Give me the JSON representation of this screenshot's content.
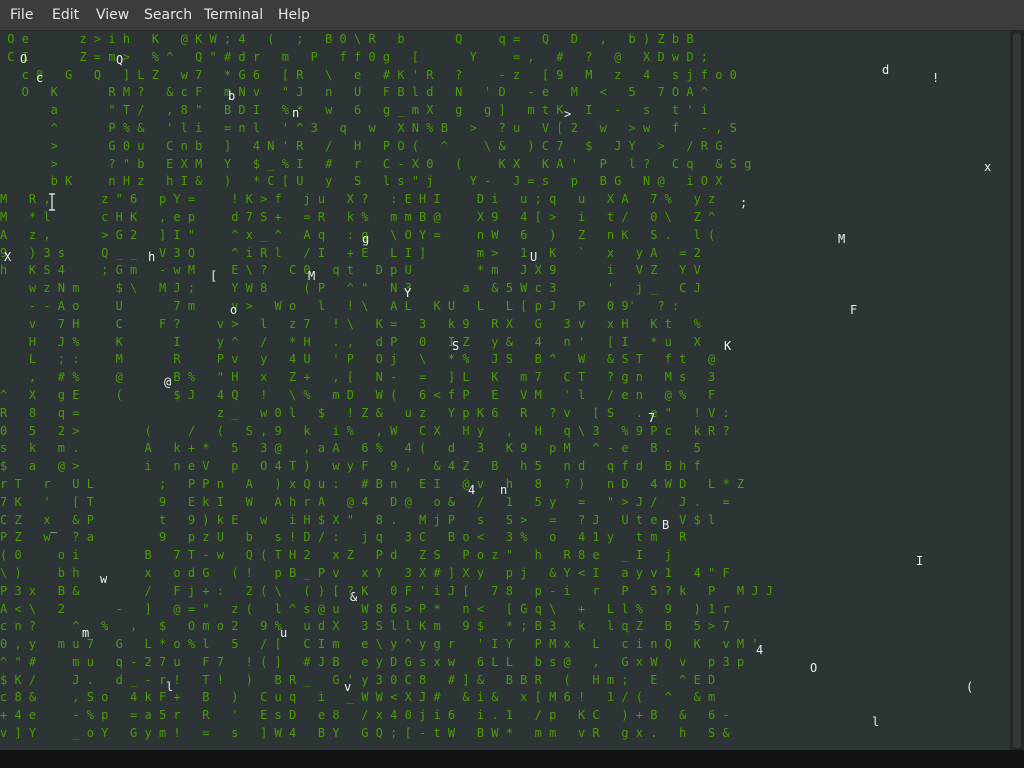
{
  "menubar": {
    "items": [
      "File",
      "Edit",
      "View",
      "Search",
      "Terminal",
      "Help"
    ]
  },
  "terminal": {
    "text_color": "#4e9a06",
    "bright_color": "#eeeeee",
    "background": "#2c3436",
    "lines": [
      " O e       z > i h   K   @ K W ; 4   (   ;   B 0 \\ R   b       Q     q =   Q   D   ,   b ) Z b B",
      " C I       Z = m >   % ^   Q \" # d r   m   P   f f 0 g   [       Y     = ,   #   ?   @   X D w D ;",
      "   c 8   G   Q   ] L Z   w 7   * G 6   [ R   \\   e   # K ' R   ?     - z   [ 9   M   z   4   s j f o 0",
      "   O   K       R M ?   & c F   m N v   \" J   n   U   F B l d   N   ' D   - e   M   <   5   7 O A ^",
      "       a       \" T /   , 8 \"   B D I   % *   w   6   g _ m X   g   g ]   m t K   I   -   s   t ' i",
      "       ^       P % &   ' l i   = n l   ' ^ 3   q   w   X N % B   >   ? u   V [ 2   w   > w   f   - , S",
      "       >       G 0 u   C n b   ]   4 N ' R   /   H   P O (   ^     \\ &   ) C 7   $   J Y   >   / R G",
      "       >       ? \" b   E X M   Y   $ _ % I   #   r   C - X 0   (     K X   K A '   P   l ?   C q   & S g",
      "       b K     n H z   h I &   )   * C [ U   y   S   l s \" j     Y -   J = s   p   B G   N @   i O X",
      "M   R ,       z \" 6   p Y =     ! K > f   j u   X ?   : E H I     D i   u ; q   u   X A   7 %   y z",
      "M   * l       c H K   , e p     d 7 S +   = R   k %   m m B @     X 9   4 [ >   i   t /   0 \\   Z ^",
      "A   z ,       > G 2   ] I \"     ^ x _ ^   A q   : g   \\ O Y =     n W   6   )   Z   n K   S .   l (",
      "9   ) 3 s     Q _ _   V 3 Q     ^ i R l   / I   + E   L I ]       m >   1   K   `   x   y A   = 2",
      "h   K S 4     ; G m   - w M     E \\ ?   C 0   q t   D p U         * m   J X 9       i   V Z   Y V",
      "    w z N m     $ \\   M J ;     Y W 8     ( P   ^ \"   N 3       a   & 5 W c 3       '   j _   C J",
      "    - - A o     U       7 m     v >   W o   l   ! \\   A L   K U   L   L [ p J   P   0 9'   ? :",
      "    v   7 H     C     F ?     v >   l   z 7   ! \\   K =   3   k 9   R X   G   3 v   x H   K t   %",
      "    H   J %     K       I     y ^   /   * H   . ,   d P   0   I Z   y &   4   n '   [ I   * u   X",
      "    L   ; :     M       R     P v   y   4 U   ' P   O j   \\   * %   J S   B ^   W   & S T   f t   @",
      "    ,   # %     @       B %   \" H   x   Z +   , [   N -   =   ] L   K   m 7   C T   ? g n   M s   3",
      "^   X   g E     (       $ J   4 Q   !   \\ %   m D   W (   6 < f P   E   V M   ' l   / e n   @ %   F",
      "R   8   q =                   z _   w 0 l   $   ! Z &   u z   Y p K 6   R   ? v   [ S   . e \"   ! V :",
      "0   5   2 >         (     /   (   S , 9   k   i %   , W   C X   H y   ,   H   q \\ 3   % 9 P c   k R ?",
      "s   k   m .         A   k + *   5   3 @   , a A   6 %   4 (   d   3   K 9   p M   ^ - e   B .   5",
      "$   a   @ >         i   n e V   p   O 4 T )   w y F   9 ,   & 4 Z   B   h 5   n d   q f d   B h f",
      "r T   r   U L         ;   P P n   A   ) x Q u :   # B n   E I   @ v   h   8   ? )   n D   4 W D   L * Z",
      "7 K   '   [ T         9   E k I   W   A h r A   @ 4   D @   o &   /   1   5 y   =   \" > J /   J .   =",
      "C Z   x   & P         t   9 ) k E   w   i H $ X \"   8 .   M j P   s   S >   =   ? J   U t e   V $ l",
      "P Z   w   ? a         9   p z U   b   s ! D / :   j q   3 C   B o <   3 %   o   4 1 y   t m   R",
      "( 0     o i         B   7 T - w   Q ( T H 2   x Z   P d   Z S   P o z \"   h   R 8 e   _ I   j",
      "\\ )     b h         x   o d G   ( !   p B _ P v   x Y   3 X # ] X y   p j   & Y < I   a y v 1   4 \" F",
      "P 3 x   B &         /   F j + :   2 ( \\   ( ) [ ? K   0 F ' i J [   7 8   p - i   r   P   5 ? k   P   M J J",
      "A < \\   2       -   ]   @ = \"   z (   l ^ s @ u   W 8 6 > P *   n <   [ G q \\   +   L l %   9   ) 1 r",
      "c n ?     ^   %   ,   $   O m o 2   9 %   u d X   3 S l l K m   9 $   * ; B 3   k   l q Z   B   5 > 7",
      "0 , y   m u 7   G   L * o % l   5   / [   C I m   e \\ y ^ y g r   ' I Y   P M x   L   c i n Q   K   v M '",
      "^ \" #     m u   q - 2 7 u   F 7   ! ( ]   # J B   e y D G s x w   6 L L   b s @   ,   G x W   v   p 3 p",
      "$ K /     J .   d _ - r !   T !   )   B R _   G ' y 3 0 C 8   # ] &   B B R   (   H m ;   E   ^ E D",
      "c 8 &     , S o   4 k F +   B   )   C u q   i   _ W W < X J #   & i &   x [ M 6 !   1 / (   ^   & m",
      "+ 4 e     - % p   = a 5 r   R   '   E s D   e 8   / x 4 0 j i 6   i . 1   / p   K C   ) + B   &   6 -",
      "v ] Y     _ o Y   G y m !   =   s   ] W 4   B Y   G Q ; [ - t W   B W *   m m   v R   g x .   h   S &"
    ],
    "highlights": [
      "O",
      "c",
      "Q",
      "n",
      ">",
      "x",
      "X",
      "h",
      ";",
      "[",
      "M",
      "Y",
      "o",
      "F",
      "S",
      "K",
      "U",
      "@",
      "4",
      "n",
      "B",
      "_",
      "I",
      "w",
      "&",
      "m",
      "d",
      "!",
      "b",
      "M",
      "g",
      "4",
      "7",
      "O",
      "(",
      "l",
      "v",
      "l",
      "u"
    ]
  }
}
